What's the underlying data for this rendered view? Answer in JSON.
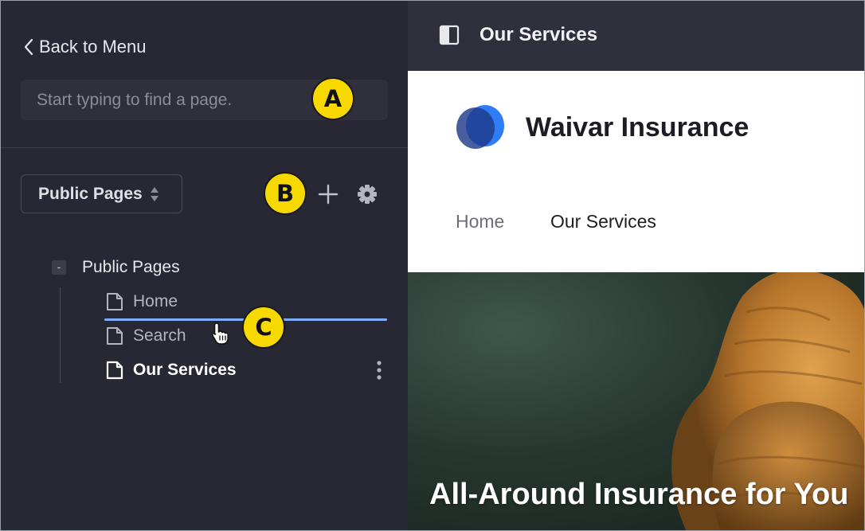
{
  "sidebar": {
    "back_label": "Back to Menu",
    "search_placeholder": "Start typing to find a page.",
    "pages_select": "Public Pages",
    "tree": {
      "root_label": "Public Pages",
      "collapse_symbol": "-",
      "items": [
        {
          "label": "Home",
          "state": "normal"
        },
        {
          "label": "Search",
          "state": "normal"
        },
        {
          "label": "Our Services",
          "state": "selected"
        }
      ]
    }
  },
  "preview": {
    "page_title": "Our Services",
    "site_name": "Waivar Insurance",
    "nav": [
      "Home",
      "Our Services"
    ],
    "hero_title": "All-Around Insurance for You"
  },
  "callouts": [
    "A",
    "B",
    "C"
  ],
  "icons": [
    "chevron-left-icon",
    "sort-caret-icon",
    "plus-icon",
    "gear-icon",
    "page-icon",
    "vertical-ellipsis-icon",
    "sidebar-panel-icon",
    "hand-pointer-icon",
    "brand-logo"
  ],
  "colors": {
    "sidebar_bg": "#272833",
    "topbar_bg": "#2f303c",
    "drop_indicator": "#80acff",
    "callout_fill": "#f7d900",
    "logo_primary": "#2e7cf6",
    "logo_secondary": "#1f3a8a"
  }
}
